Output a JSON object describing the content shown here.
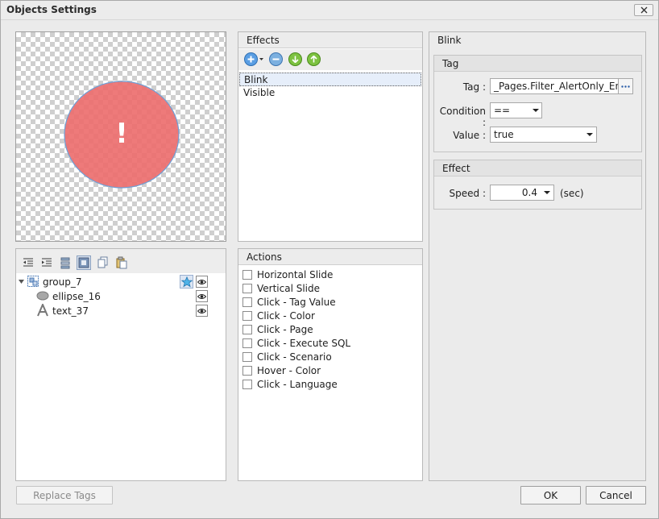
{
  "window": {
    "title": "Objects Settings"
  },
  "preview": {
    "glyph": "!"
  },
  "tree": {
    "items": [
      {
        "label": "group_7"
      },
      {
        "label": "ellipse_16"
      },
      {
        "label": "text_37"
      }
    ]
  },
  "effects": {
    "header": "Effects",
    "items": [
      {
        "label": "Blink"
      },
      {
        "label": "Visible"
      }
    ]
  },
  "actions": {
    "header": "Actions",
    "items": [
      {
        "label": "Horizontal Slide"
      },
      {
        "label": "Vertical Slide"
      },
      {
        "label": "Click - Tag Value"
      },
      {
        "label": "Click - Color"
      },
      {
        "label": "Click - Page"
      },
      {
        "label": "Click - Execute SQL"
      },
      {
        "label": "Click - Scenario"
      },
      {
        "label": "Hover - Color"
      },
      {
        "label": "Click - Language"
      }
    ]
  },
  "details": {
    "header": "Blink",
    "tag_group": {
      "header": "Tag",
      "tag_label": "Tag :",
      "tag_value": "_Pages.Filter_AlertOnly_En",
      "condition_label": "Condition :",
      "condition_value": "==",
      "value_label": "Value :",
      "value_value": "true"
    },
    "effect_group": {
      "header": "Effect",
      "speed_label": "Speed :",
      "speed_value": "0.4",
      "speed_unit": "(sec)"
    }
  },
  "footer": {
    "replace_tags": "Replace Tags",
    "ok": "OK",
    "cancel": "Cancel"
  },
  "colors": {
    "ellipse_fill": "#ec6b6b",
    "ellipse_stroke": "#6f9fd6"
  }
}
